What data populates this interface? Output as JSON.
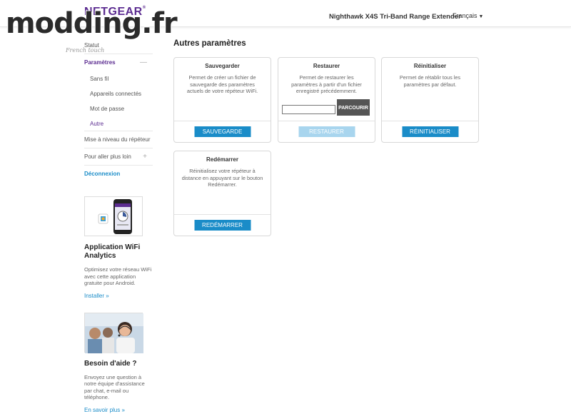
{
  "header": {
    "logo": "NETGEAR",
    "logo_mark": "®",
    "product": "Nighthawk X4S Tri-Band Range Extender",
    "language": "Français"
  },
  "watermark": {
    "text": "modding.fr",
    "sub": "French touch"
  },
  "sidebar": {
    "items": [
      {
        "label": "Statut"
      },
      {
        "label": "Paramètres",
        "sign": "—"
      },
      {
        "label": "Sans fil"
      },
      {
        "label": "Appareils connectés"
      },
      {
        "label": "Mot de passe"
      },
      {
        "label": "Autre"
      },
      {
        "label": "Mise à niveau du répéteur"
      },
      {
        "label": "Pour aller plus loin",
        "sign": "+"
      },
      {
        "label": "Déconnexion"
      }
    ],
    "promo_app": {
      "title": "Application WiFi Analytics",
      "text": "Optimisez votre réseau WiFi avec cette application gratuite pour Android.",
      "link": "Installer »"
    },
    "promo_help": {
      "title": "Besoin d'aide ?",
      "text": "Envoyez une question à notre équipe d'assistance par chat, e-mail ou téléphone.",
      "link": "En savoir plus »"
    }
  },
  "main": {
    "title": "Autres paramètres",
    "cards": [
      {
        "title": "Sauvegarder",
        "desc": "Permet de créer un fichier de sauvegarde des paramètres actuels de votre répéteur WiFi.",
        "button": "SAUVEGARDE"
      },
      {
        "title": "Restaurer",
        "desc": "Permet de restaurer les paramètres à partir d'un fichier enregistré précédemment.",
        "browse": "PARCOURIR",
        "file_value": "",
        "button": "RESTAURER"
      },
      {
        "title": "Réinitialiser",
        "desc": "Permet de rétablir tous les paramètres par défaut.",
        "button": "RÉINITIALISER"
      },
      {
        "title": "Redémarrer",
        "desc": "Réinitialisez votre répéteur à distance en appuyant sur le bouton Redémarrer.",
        "button": "REDÉMARRER"
      }
    ]
  },
  "colors": {
    "brand": "#5c2d91",
    "button": "#1a8cc8",
    "button_disabled": "#a8d5ee",
    "link": "#1a8cc8"
  }
}
